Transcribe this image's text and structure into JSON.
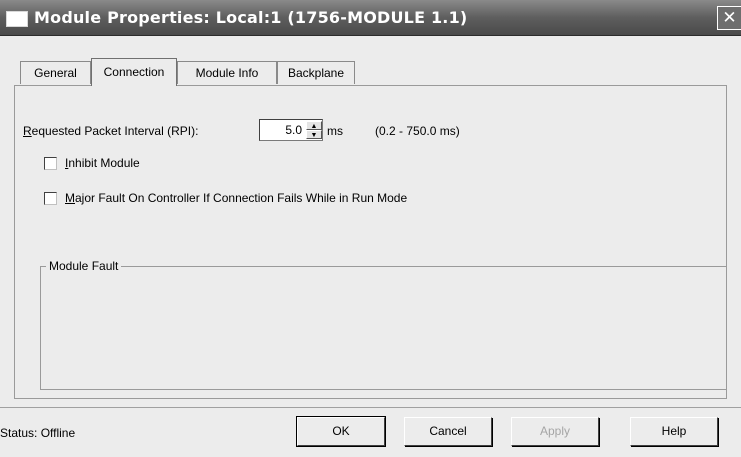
{
  "window": {
    "title": "Module Properties: Local:1 (1756-MODULE 1.1)",
    "close_glyph": "✕"
  },
  "tabs": [
    {
      "label": "General",
      "active": false
    },
    {
      "label": "Connection",
      "active": true
    },
    {
      "label": "Module Info",
      "active": false
    },
    {
      "label": "Backplane",
      "active": false
    }
  ],
  "rpi": {
    "label_mnemonic": "R",
    "label_rest": "equested Packet Interval (RPI):",
    "value": "5.0",
    "unit": "ms",
    "range": "(0.2 - 750.0 ms)",
    "spin_up": "▲",
    "spin_down": "▼"
  },
  "options": {
    "inhibit": {
      "mnemonic": "I",
      "rest": "nhibit Module",
      "checked": false
    },
    "major_fault": {
      "mnemonic": "M",
      "rest": "ajor Fault On Controller If Connection Fails While in Run Mode",
      "checked": false
    }
  },
  "module_fault": {
    "legend": "Module Fault"
  },
  "status": {
    "text": "Status:  Offline"
  },
  "buttons": {
    "ok": "OK",
    "cancel": "Cancel",
    "apply": "Apply",
    "help": "Help"
  }
}
